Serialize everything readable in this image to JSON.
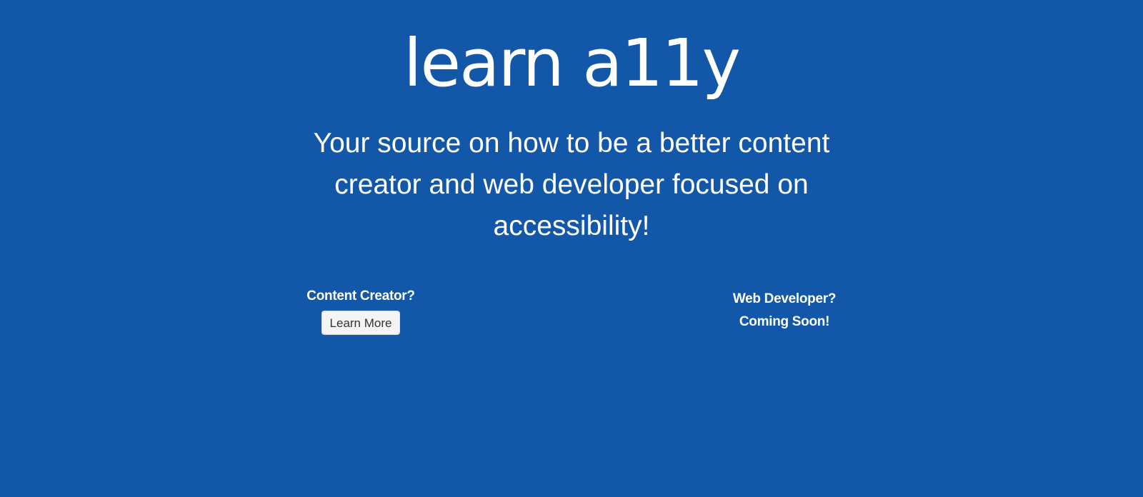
{
  "header": {
    "logo_text": "learn a11y",
    "tagline": "Your source on how to be a better content creator and web developer focused on accessibility!"
  },
  "content_creator": {
    "heading": "Content Creator?",
    "button_label": "Learn More"
  },
  "web_developer": {
    "heading": "Web Developer?",
    "status": "Coming Soon!"
  },
  "colors": {
    "background": "#1358a8",
    "text": "#ffffff",
    "button_bg": "#f4f4f4",
    "button_text": "#333333"
  }
}
